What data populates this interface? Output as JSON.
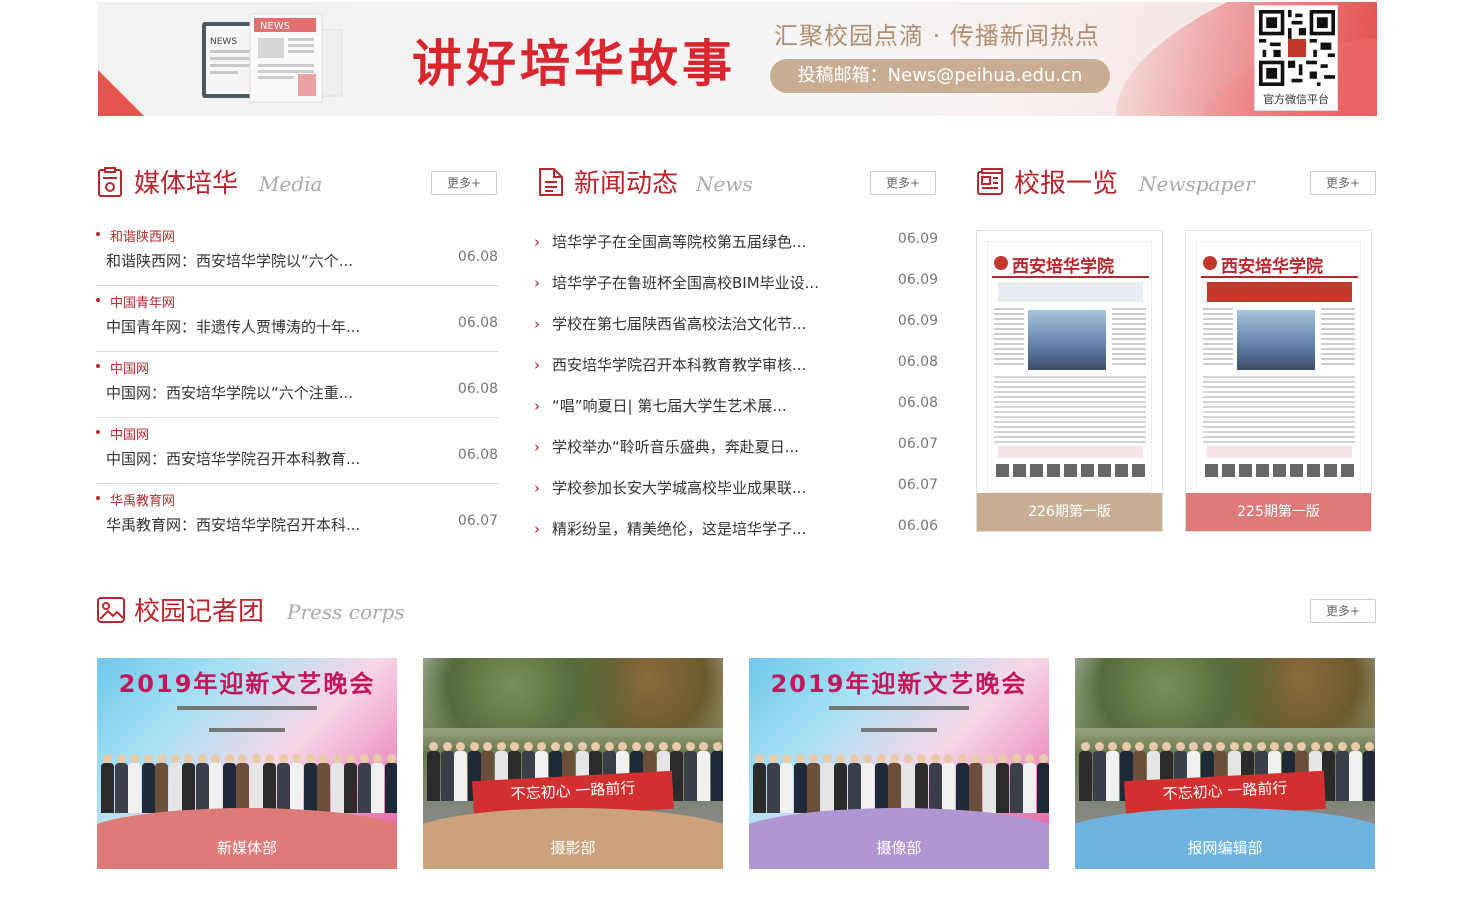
{
  "banner": {
    "title": "讲好培华故事",
    "slogan": "汇聚校园点滴 · 传播新闻热点",
    "email": "投稿邮箱：News@peihua.edu.cn",
    "qr_label": "官方微信平台",
    "news_label": "NEWS",
    "news_label2": "NEWS"
  },
  "sections": {
    "media": {
      "title": "媒体培华",
      "en": "Media",
      "more": "更多+"
    },
    "news": {
      "title": "新闻动态",
      "en": "News",
      "more": "更多+"
    },
    "paper": {
      "title": "校报一览",
      "en": "Newspaper",
      "more": "更多+"
    },
    "corps": {
      "title": "校园记者团",
      "en": "Press corps",
      "more": "更多+"
    }
  },
  "media_items": [
    {
      "source": "和谐陕西网",
      "title": "和谐陕西网：西安培华学院以“六个...",
      "date": "06.08"
    },
    {
      "source": "中国青年网",
      "title": "中国青年网：非遗传人贾博涛的十年...",
      "date": "06.08"
    },
    {
      "source": "中国网",
      "title": "中国网：西安培华学院以“六个注重...",
      "date": "06.08"
    },
    {
      "source": "中国网",
      "title": "中国网：西安培华学院召开本科教育...",
      "date": "06.08"
    },
    {
      "source": "华禹教育网",
      "title": "华禹教育网：西安培华学院召开本科...",
      "date": "06.07"
    }
  ],
  "news_items": [
    {
      "title": "培华学子在全国高等院校第五届绿色...",
      "date": "06.09"
    },
    {
      "title": "培华学子在鲁班杯全国高校BIM毕业设...",
      "date": "06.09"
    },
    {
      "title": "学校在第七届陕西省高校法治文化节...",
      "date": "06.09"
    },
    {
      "title": "西安培华学院召开本科教育教学审核...",
      "date": "06.08"
    },
    {
      "title": "“唱”响夏日| 第七届大学生艺术展...",
      "date": "06.08"
    },
    {
      "title": "学校举办“聆听音乐盛典，奔赴夏日...",
      "date": "06.07"
    },
    {
      "title": "学校参加长安大学城高校毕业成果联...",
      "date": "06.07"
    },
    {
      "title": "精彩纷呈，精美绝伦，这是培华学子...",
      "date": "06.06"
    }
  ],
  "papers": [
    {
      "caption": "226期第一版",
      "masthead": "西安培华学院",
      "color": "#c8ae93"
    },
    {
      "caption": "225期第一版",
      "masthead": "西安培华学院",
      "color": "#dc7b78"
    }
  ],
  "corps": [
    {
      "caption": "新媒体部",
      "color": "#dc7b78",
      "banner": "2019年迎新文艺晚会",
      "kind": "stage"
    },
    {
      "caption": "摄影部",
      "color": "#cca27b",
      "banner": "不忘初心 一路前行",
      "kind": "outdoor"
    },
    {
      "caption": "摄像部",
      "color": "#b196d4",
      "banner": "2019年迎新文艺晚会",
      "kind": "stage"
    },
    {
      "caption": "报网编辑部",
      "color": "#6fb4e0",
      "banner": "不忘初心 一路前行",
      "kind": "outdoor"
    }
  ],
  "colors": {
    "brand_red": "#b9262c",
    "banner_red": "#d8262e"
  }
}
